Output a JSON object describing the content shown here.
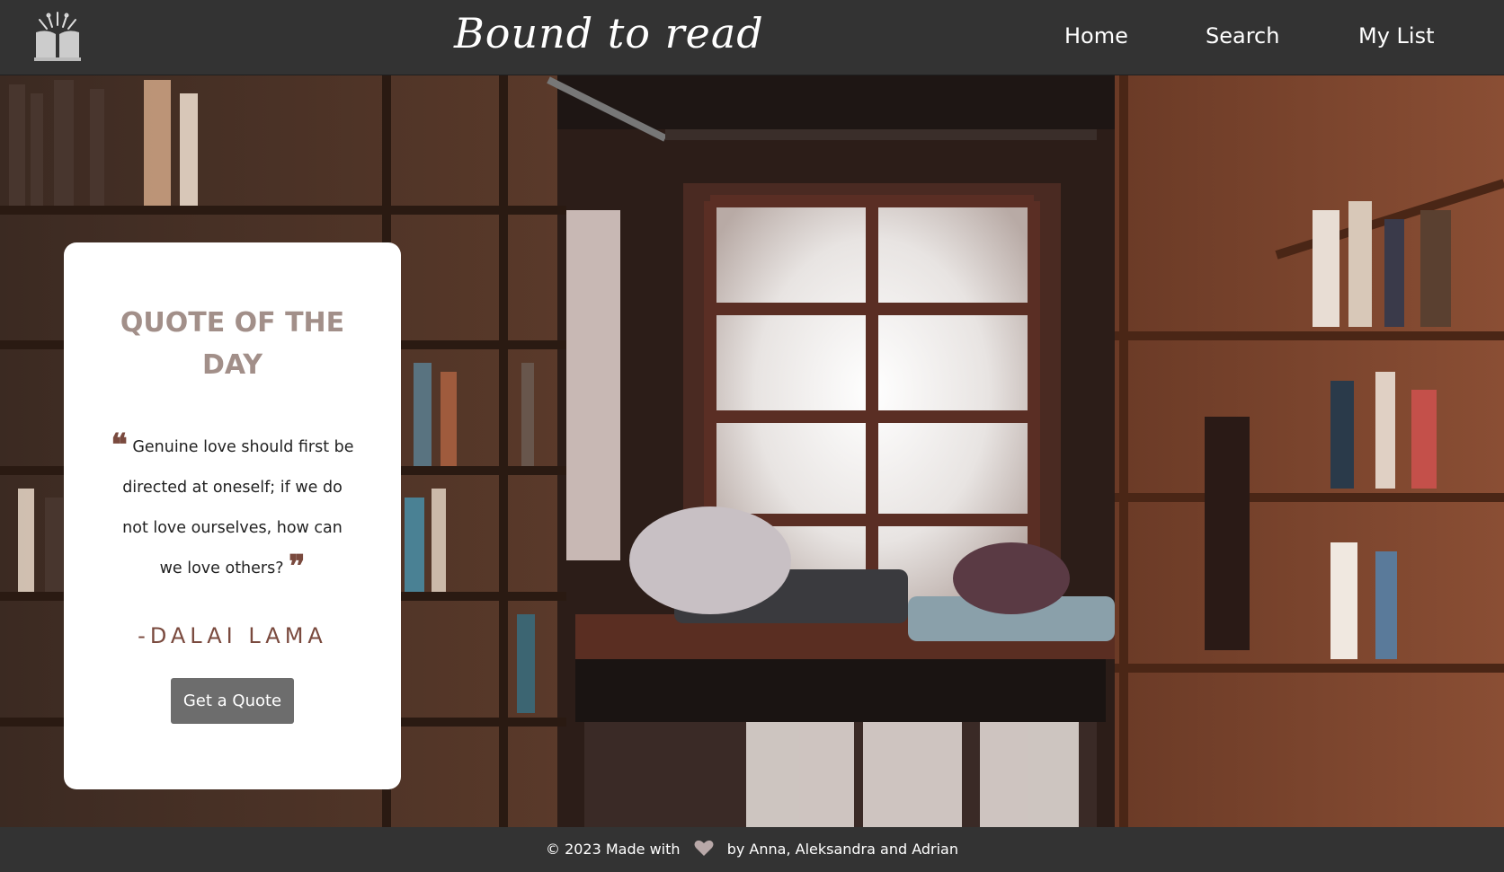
{
  "header": {
    "brand": "Bound to read",
    "logo_icon": "open-book-icon",
    "nav": {
      "home": "Home",
      "search": "Search",
      "my_list": "My List"
    }
  },
  "hero": {
    "background_icon": "bookshop-window-photo"
  },
  "quote_card": {
    "title": "QUOTE OF THE DAY",
    "open_quote": "❝",
    "close_quote": "❞",
    "text": "Genuine love should first be directed at oneself; if we do not love ourselves, how can we love others?",
    "author": "-Dalai Lama",
    "button_label": "Get a Quote"
  },
  "footer": {
    "prefix": "© 2023 Made with",
    "heart_icon": "heart-icon",
    "suffix": "by Anna, Aleksandra and Adrian"
  },
  "colors": {
    "nav_background": "#333333",
    "accent_brown": "#7a4a3e",
    "title_mauve": "#a28f89",
    "button_grey": "#6d6d6d"
  }
}
